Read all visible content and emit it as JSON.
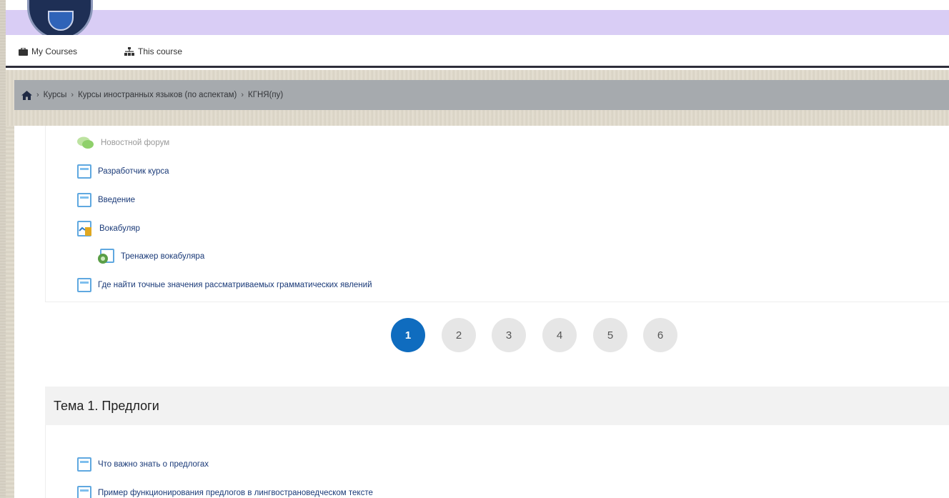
{
  "nav": {
    "my_courses": "My Courses",
    "this_course": "This course"
  },
  "breadcrumb": {
    "items": [
      "Курсы",
      "Курсы иностранных языков (по аспектам)",
      "КГНЯ(пу)"
    ]
  },
  "section0": {
    "activities": [
      {
        "label": "Новостной форум",
        "icon": "forum-icon",
        "dim": true
      },
      {
        "label": "Разработчик курса",
        "icon": "page-icon"
      },
      {
        "label": "Введение",
        "icon": "page-icon"
      },
      {
        "label": "Вокабуляр",
        "icon": "book-icon"
      },
      {
        "label": "Тренажер вокабуляра",
        "icon": "quiz-icon",
        "indent": true
      },
      {
        "label": "Где найти точные значения рассматриваемых грамматических явлений",
        "icon": "page-icon"
      }
    ]
  },
  "pagination": {
    "pages": [
      "1",
      "2",
      "3",
      "4",
      "5",
      "6"
    ],
    "current": "1"
  },
  "topic1": {
    "title": "Тема 1. Предлоги",
    "activities": [
      {
        "label": "Что важно знать о предлогах",
        "icon": "page-icon"
      },
      {
        "label": "Пример функционирования предлогов в лингвострановедческом тексте",
        "icon": "page-icon"
      }
    ]
  },
  "colors": {
    "header_bar": "#d9cdf5",
    "breadcrumb_bg": "#a6aaae",
    "active_page": "#0f6cbf",
    "link": "#1a3a78"
  }
}
